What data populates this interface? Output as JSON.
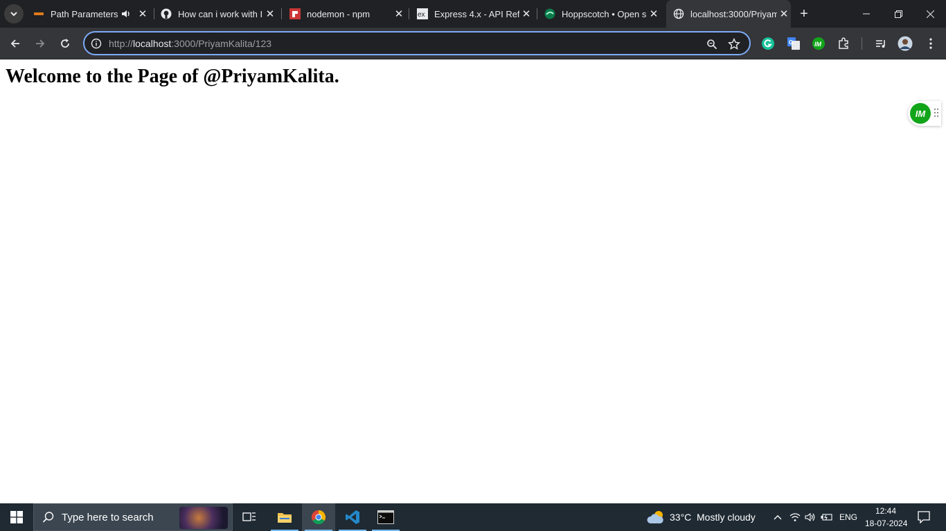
{
  "tabs": [
    {
      "title": "Path Parameters",
      "favicon": "course-site-icon"
    },
    {
      "title": "How can i work with I",
      "favicon": "github-icon"
    },
    {
      "title": "nodemon - npm",
      "favicon": "npm-icon"
    },
    {
      "title": "Express 4.x - API Refe",
      "favicon": "express-icon"
    },
    {
      "title": "Hoppscotch • Open s",
      "favicon": "hoppscotch-icon"
    },
    {
      "title": "localhost:3000/Priyam",
      "favicon": "globe-icon"
    }
  ],
  "address_bar": {
    "scheme": "http://",
    "host": "localhost",
    "path": ":3000/PriyamKalita/123"
  },
  "page": {
    "heading": "Welcome to the Page of @PriyamKalita.",
    "floating_badge": "IM"
  },
  "taskbar": {
    "search_placeholder": "Type here to search",
    "weather_temp": "33°C",
    "weather_desc": "Mostly cloudy",
    "language": "ENG",
    "time": "12:44",
    "date": "18-07-2024"
  },
  "colors": {
    "tabstrip": "#202124",
    "toolbar": "#35363a",
    "omnibox_border": "#7cacf8",
    "taskbar": "#1f2a33",
    "im_green": "#12a51a"
  }
}
